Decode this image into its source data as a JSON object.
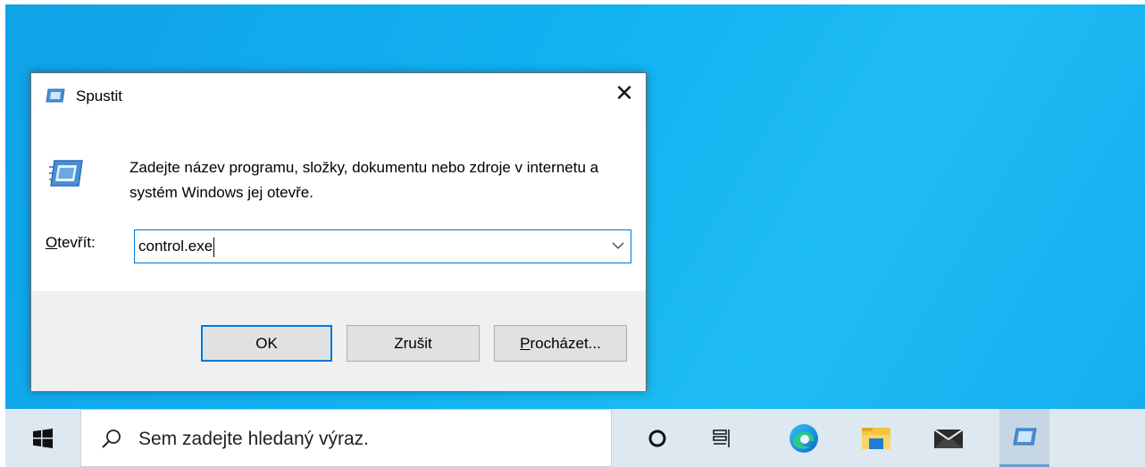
{
  "dialog": {
    "title": "Spustit",
    "close_glyph": "✕",
    "description": "Zadejte název programu, složky, dokumentu nebo zdroje v internetu a systém Windows jej otevře.",
    "open_label_underlined": "O",
    "open_label_rest": "tevřít:",
    "input_value": "control.exe",
    "ok_label": "OK",
    "cancel_label": "Zrušit",
    "browse_label_underlined": "P",
    "browse_label_rest": "rocházet..."
  },
  "taskbar": {
    "search_placeholder": "Sem zadejte hledaný výraz.",
    "icons": [
      "windows-start-icon",
      "search-icon",
      "cortana-icon",
      "task-view-icon",
      "edge-icon",
      "file-explorer-icon",
      "mail-icon",
      "run-icon"
    ]
  },
  "colors": {
    "desktop": "#13b2f1",
    "taskbar": "#dde8f1",
    "accent": "#0078d7",
    "dialog_footer": "#f0f0f0"
  }
}
